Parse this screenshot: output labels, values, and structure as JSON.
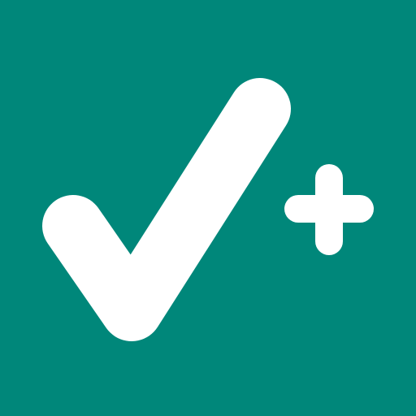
{
  "icon": {
    "name": "checkmark-plus",
    "background_color": "#00877A",
    "foreground_color": "#FFFFFF",
    "glyphs": [
      "checkmark-icon",
      "plus-icon"
    ]
  }
}
